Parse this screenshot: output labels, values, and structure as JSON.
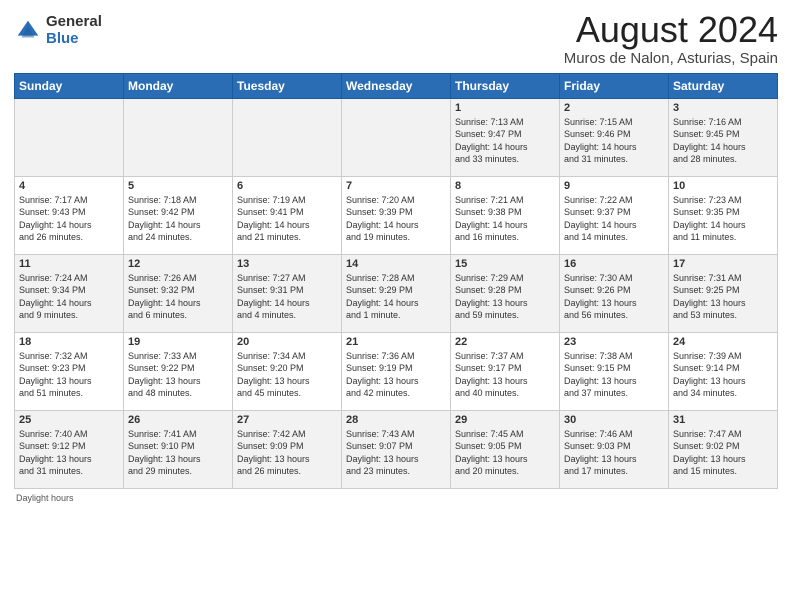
{
  "logo": {
    "general": "General",
    "blue": "Blue"
  },
  "header": {
    "month": "August 2024",
    "location": "Muros de Nalon, Asturias, Spain"
  },
  "days_of_week": [
    "Sunday",
    "Monday",
    "Tuesday",
    "Wednesday",
    "Thursday",
    "Friday",
    "Saturday"
  ],
  "weeks": [
    [
      {
        "day": "",
        "detail": ""
      },
      {
        "day": "",
        "detail": ""
      },
      {
        "day": "",
        "detail": ""
      },
      {
        "day": "",
        "detail": ""
      },
      {
        "day": "1",
        "detail": "Sunrise: 7:13 AM\nSunset: 9:47 PM\nDaylight: 14 hours\nand 33 minutes."
      },
      {
        "day": "2",
        "detail": "Sunrise: 7:15 AM\nSunset: 9:46 PM\nDaylight: 14 hours\nand 31 minutes."
      },
      {
        "day": "3",
        "detail": "Sunrise: 7:16 AM\nSunset: 9:45 PM\nDaylight: 14 hours\nand 28 minutes."
      }
    ],
    [
      {
        "day": "4",
        "detail": "Sunrise: 7:17 AM\nSunset: 9:43 PM\nDaylight: 14 hours\nand 26 minutes."
      },
      {
        "day": "5",
        "detail": "Sunrise: 7:18 AM\nSunset: 9:42 PM\nDaylight: 14 hours\nand 24 minutes."
      },
      {
        "day": "6",
        "detail": "Sunrise: 7:19 AM\nSunset: 9:41 PM\nDaylight: 14 hours\nand 21 minutes."
      },
      {
        "day": "7",
        "detail": "Sunrise: 7:20 AM\nSunset: 9:39 PM\nDaylight: 14 hours\nand 19 minutes."
      },
      {
        "day": "8",
        "detail": "Sunrise: 7:21 AM\nSunset: 9:38 PM\nDaylight: 14 hours\nand 16 minutes."
      },
      {
        "day": "9",
        "detail": "Sunrise: 7:22 AM\nSunset: 9:37 PM\nDaylight: 14 hours\nand 14 minutes."
      },
      {
        "day": "10",
        "detail": "Sunrise: 7:23 AM\nSunset: 9:35 PM\nDaylight: 14 hours\nand 11 minutes."
      }
    ],
    [
      {
        "day": "11",
        "detail": "Sunrise: 7:24 AM\nSunset: 9:34 PM\nDaylight: 14 hours\nand 9 minutes."
      },
      {
        "day": "12",
        "detail": "Sunrise: 7:26 AM\nSunset: 9:32 PM\nDaylight: 14 hours\nand 6 minutes."
      },
      {
        "day": "13",
        "detail": "Sunrise: 7:27 AM\nSunset: 9:31 PM\nDaylight: 14 hours\nand 4 minutes."
      },
      {
        "day": "14",
        "detail": "Sunrise: 7:28 AM\nSunset: 9:29 PM\nDaylight: 14 hours\nand 1 minute."
      },
      {
        "day": "15",
        "detail": "Sunrise: 7:29 AM\nSunset: 9:28 PM\nDaylight: 13 hours\nand 59 minutes."
      },
      {
        "day": "16",
        "detail": "Sunrise: 7:30 AM\nSunset: 9:26 PM\nDaylight: 13 hours\nand 56 minutes."
      },
      {
        "day": "17",
        "detail": "Sunrise: 7:31 AM\nSunset: 9:25 PM\nDaylight: 13 hours\nand 53 minutes."
      }
    ],
    [
      {
        "day": "18",
        "detail": "Sunrise: 7:32 AM\nSunset: 9:23 PM\nDaylight: 13 hours\nand 51 minutes."
      },
      {
        "day": "19",
        "detail": "Sunrise: 7:33 AM\nSunset: 9:22 PM\nDaylight: 13 hours\nand 48 minutes."
      },
      {
        "day": "20",
        "detail": "Sunrise: 7:34 AM\nSunset: 9:20 PM\nDaylight: 13 hours\nand 45 minutes."
      },
      {
        "day": "21",
        "detail": "Sunrise: 7:36 AM\nSunset: 9:19 PM\nDaylight: 13 hours\nand 42 minutes."
      },
      {
        "day": "22",
        "detail": "Sunrise: 7:37 AM\nSunset: 9:17 PM\nDaylight: 13 hours\nand 40 minutes."
      },
      {
        "day": "23",
        "detail": "Sunrise: 7:38 AM\nSunset: 9:15 PM\nDaylight: 13 hours\nand 37 minutes."
      },
      {
        "day": "24",
        "detail": "Sunrise: 7:39 AM\nSunset: 9:14 PM\nDaylight: 13 hours\nand 34 minutes."
      }
    ],
    [
      {
        "day": "25",
        "detail": "Sunrise: 7:40 AM\nSunset: 9:12 PM\nDaylight: 13 hours\nand 31 minutes."
      },
      {
        "day": "26",
        "detail": "Sunrise: 7:41 AM\nSunset: 9:10 PM\nDaylight: 13 hours\nand 29 minutes."
      },
      {
        "day": "27",
        "detail": "Sunrise: 7:42 AM\nSunset: 9:09 PM\nDaylight: 13 hours\nand 26 minutes."
      },
      {
        "day": "28",
        "detail": "Sunrise: 7:43 AM\nSunset: 9:07 PM\nDaylight: 13 hours\nand 23 minutes."
      },
      {
        "day": "29",
        "detail": "Sunrise: 7:45 AM\nSunset: 9:05 PM\nDaylight: 13 hours\nand 20 minutes."
      },
      {
        "day": "30",
        "detail": "Sunrise: 7:46 AM\nSunset: 9:03 PM\nDaylight: 13 hours\nand 17 minutes."
      },
      {
        "day": "31",
        "detail": "Sunrise: 7:47 AM\nSunset: 9:02 PM\nDaylight: 13 hours\nand 15 minutes."
      }
    ]
  ],
  "footer": {
    "text": "Daylight hours"
  }
}
